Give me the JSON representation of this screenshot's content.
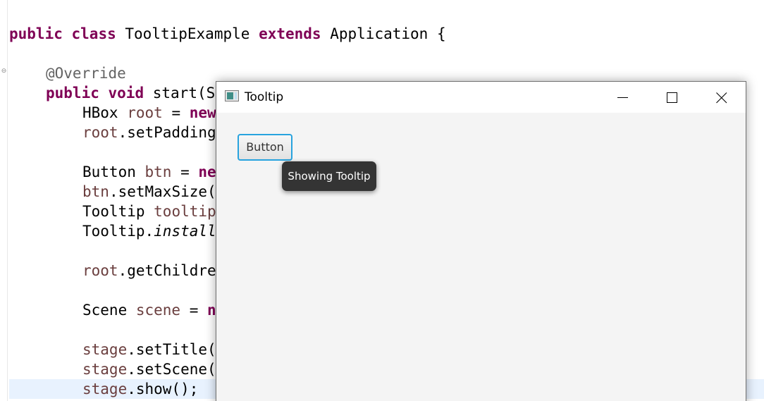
{
  "editor": {
    "line_class": {
      "kw_public": "public",
      "kw_class": "class",
      "class_name": "TooltipExample",
      "kw_extends": "extends",
      "super_name": "Application {"
    },
    "line_override": "@Override",
    "line_start": {
      "kw_public": "public",
      "kw_void": "void",
      "rest": "start(S"
    },
    "line_hbox": {
      "type": "HBox ",
      "var": "root",
      "op": " = ",
      "kw_new": "new"
    },
    "line_padding": {
      "var": "root",
      "rest": ".setPadding"
    },
    "line_button": {
      "type": "Button ",
      "var": "btn",
      "op": " = ",
      "kw_new": "ne"
    },
    "line_maxsize": {
      "var": "btn",
      "rest": ".setMaxSize("
    },
    "line_tooltip": {
      "type": "Tooltip ",
      "var": "tooltip"
    },
    "line_install": {
      "type": "Tooltip.",
      "method": "install"
    },
    "line_children": {
      "var": "root",
      "rest": ".getChildre"
    },
    "line_scene": {
      "type": "Scene ",
      "var": "scene",
      "op": " = ",
      "kw_new": "n"
    },
    "line_settitle": {
      "var": "stage",
      "rest": ".setTitle("
    },
    "line_setscene": {
      "var": "stage",
      "rest": ".setScene("
    },
    "line_show": {
      "var": "stage",
      "rest": ".show();"
    },
    "colors": {
      "keyword": "#7f0055",
      "annotation": "#646464",
      "variable": "#6a3e3e",
      "current_line": "#e8f2fe"
    }
  },
  "window": {
    "title": "Tooltip",
    "icon": "javafx-app-icon",
    "controls": [
      "minimize-icon",
      "maximize-icon",
      "close-icon"
    ]
  },
  "content": {
    "button_label": "Button",
    "tooltip_text": "Showing Tooltip",
    "focus_color": "#28a3de"
  }
}
